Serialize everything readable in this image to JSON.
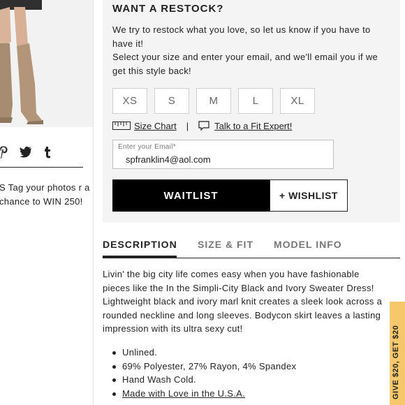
{
  "left": {
    "social_icons": [
      "pinterest-icon",
      "twitter-icon",
      "tumblr-icon"
    ],
    "promo_text": "S Tag your photos r a chance to WIN 250!"
  },
  "restock": {
    "title": "WANT A RESTOCK?",
    "intro": "We try to restock what you love, so let us know if you have to have it!",
    "instruction": "Select your size and enter your email, and we'll email you if we get this style back!",
    "sizes": [
      "XS",
      "S",
      "M",
      "L",
      "XL"
    ],
    "size_chart_label": "Size Chart",
    "separator": "|",
    "fit_expert_label": "Talk to a Fit Expert!",
    "email_label": "Enter your Email*",
    "email_value": "spfranklin4@aol.com",
    "waitlist_label": "WAITLIST",
    "wishlist_label": "+ WISHLIST"
  },
  "tabs": [
    {
      "label": "DESCRIPTION",
      "active": true
    },
    {
      "label": "SIZE & FIT",
      "active": false
    },
    {
      "label": "MODEL INFO",
      "active": false
    }
  ],
  "description": {
    "body": "Livin' the big city life comes easy when you have fashionable pieces like the In the Simpli-City Black and Ivory Sweater Dress! Lightweight black and ivory marl knit creates a sleek look across a rounded neckline and long sleeves. Bodycon skirt leaves a lasting impression with its ultra sexy cut!",
    "bullets": [
      "Unlined.",
      "69% Polyester, 27% Rayon, 4% Spandex",
      "Hand Wash Cold.",
      "Made with Love in the U.S.A."
    ]
  },
  "side_promo": {
    "text": "GIVE $20, GET $20"
  },
  "colors": {
    "panel_bg": "#f4f4f4",
    "button_black": "#000000",
    "promo_yellow": "#f6c76b"
  }
}
